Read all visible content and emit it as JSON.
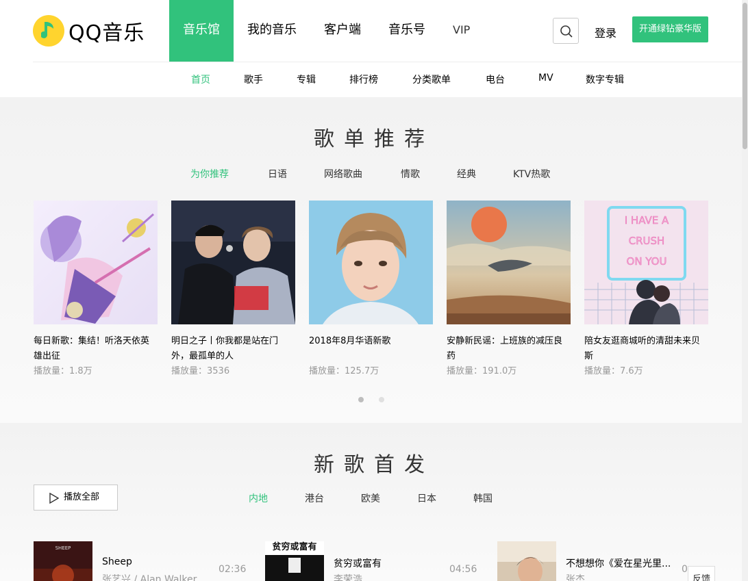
{
  "header": {
    "logo_text": "QQ音乐",
    "nav": [
      "音乐馆",
      "我的音乐",
      "客户端",
      "音乐号",
      "VIP"
    ],
    "login_label": "登录",
    "vip_button_label": "开通绿钻豪华版"
  },
  "subnav": [
    "首页",
    "歌手",
    "专辑",
    "排行榜",
    "分类歌单",
    "电台",
    "MV",
    "数字专辑"
  ],
  "playlist_section": {
    "title": "歌单推荐",
    "tabs": [
      "为你推荐",
      "日语",
      "网络歌曲",
      "情歌",
      "经典",
      "KTV热歌"
    ],
    "cards": [
      {
        "title": "每日新歌：集结！听洛天依英雄出征",
        "plays": "播放量：1.8万"
      },
      {
        "title": "明日之子丨你我都是站在门外，最孤单的人",
        "plays": "播放量：3536"
      },
      {
        "title": "2018年8月华语新歌",
        "plays": "播放量：125.7万"
      },
      {
        "title": "安静新民谣：上班族的减压良药",
        "plays": "播放量：191.0万"
      },
      {
        "title": "陪女友逛商城听的清甜未来贝斯",
        "plays": "播放量：7.6万"
      }
    ],
    "cover_texts": {
      "card5_line1": "I HAVE A",
      "card5_line2": "CRUSH",
      "card5_line3": "ON YOU"
    }
  },
  "new_songs_section": {
    "title": "新歌首发",
    "play_all_label": "播放全部",
    "tabs": [
      "内地",
      "港台",
      "欧美",
      "日本",
      "韩国"
    ],
    "songs": [
      {
        "name": "Sheep",
        "artist": "张艺兴 / Alan Walker",
        "time": "02:36",
        "cover_text": "SHEEP"
      },
      {
        "name": "贫穷或富有",
        "artist": "李荣浩",
        "time": "04:56",
        "cover_text": "贫穷或富有"
      },
      {
        "name": "不想想你《爱在星光里...",
        "artist": "张杰",
        "time": "0"
      }
    ],
    "feedback_label": "反馈"
  },
  "colors": {
    "accent": "#31c27c",
    "logo_yellow": "#ffd42e"
  }
}
